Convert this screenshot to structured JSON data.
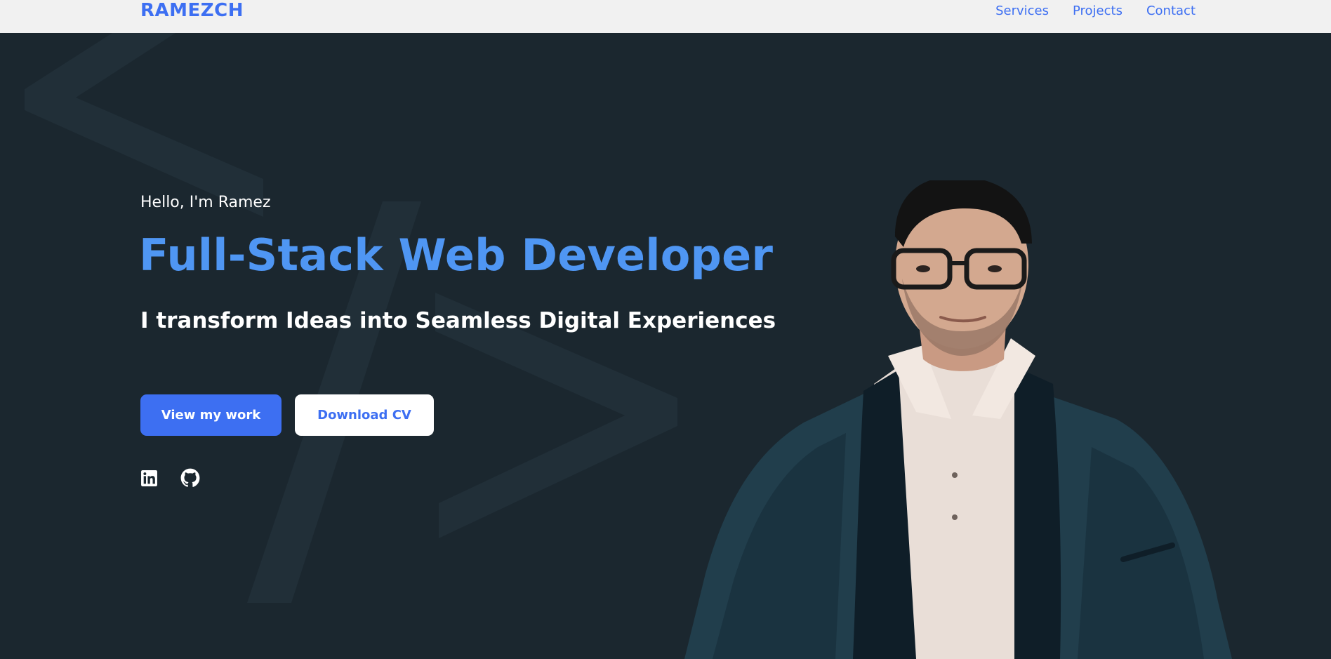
{
  "header": {
    "logo": "RAMEZCH",
    "nav": [
      {
        "label": "Services"
      },
      {
        "label": "Projects"
      },
      {
        "label": "Contact"
      }
    ]
  },
  "hero": {
    "greeting": "Hello, I'm Ramez",
    "headline": "Full-Stack Web Developer",
    "tagline": "I transform Ideas into Seamless Digital Experiences",
    "primary_button": "View my work",
    "secondary_button": "Download CV",
    "socials": [
      {
        "icon": "linkedin-icon"
      },
      {
        "icon": "github-icon"
      }
    ],
    "background_glyph": "</>"
  },
  "colors": {
    "accent": "#3d6ff2",
    "headline": "#4f96f3",
    "hero_bg": "#1b272f",
    "nav_bg": "#f1f1f1"
  }
}
